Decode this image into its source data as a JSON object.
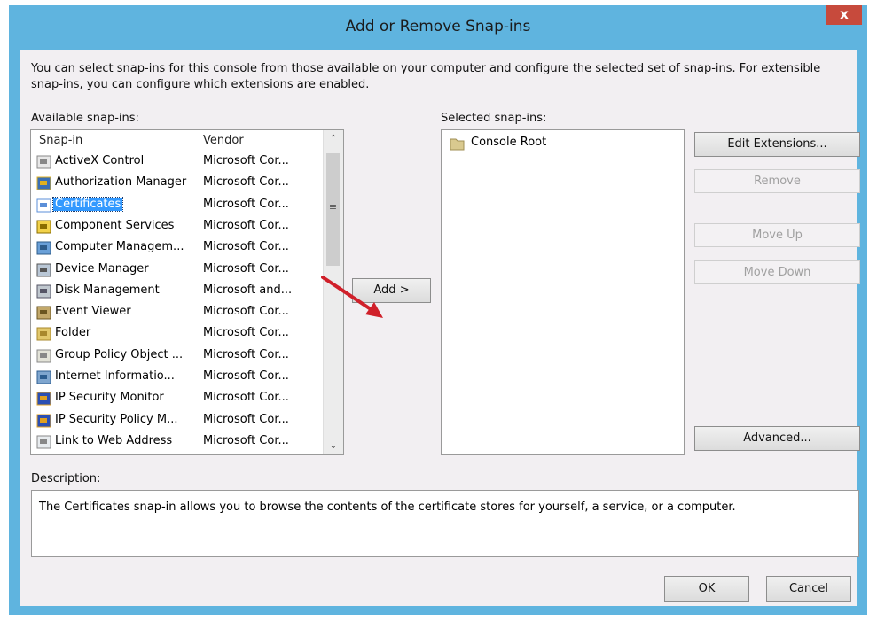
{
  "window": {
    "title": "Add or Remove Snap-ins",
    "close_label": "x"
  },
  "intro_text": "You can select snap-ins for this console from those available on your computer and configure the selected set of snap-ins. For extensible snap-ins, you can configure which extensions are enabled.",
  "available": {
    "label": "Available snap-ins:",
    "columns": [
      "Snap-in",
      "Vendor"
    ],
    "items": [
      {
        "name": "ActiveX Control",
        "vendor": "Microsoft Cor...",
        "icon": "activex-icon"
      },
      {
        "name": "Authorization Manager",
        "vendor": "Microsoft Cor...",
        "icon": "authorization-icon"
      },
      {
        "name": "Certificates",
        "vendor": "Microsoft Cor...",
        "icon": "certificate-icon",
        "selected": true
      },
      {
        "name": "Component Services",
        "vendor": "Microsoft Cor...",
        "icon": "component-services-icon"
      },
      {
        "name": "Computer Managem...",
        "vendor": "Microsoft Cor...",
        "icon": "computer-management-icon"
      },
      {
        "name": "Device Manager",
        "vendor": "Microsoft Cor...",
        "icon": "device-manager-icon"
      },
      {
        "name": "Disk Management",
        "vendor": "Microsoft and...",
        "icon": "disk-icon"
      },
      {
        "name": "Event Viewer",
        "vendor": "Microsoft Cor...",
        "icon": "event-viewer-icon"
      },
      {
        "name": "Folder",
        "vendor": "Microsoft Cor...",
        "icon": "folder-icon"
      },
      {
        "name": "Group Policy Object ...",
        "vendor": "Microsoft Cor...",
        "icon": "group-policy-icon"
      },
      {
        "name": "Internet Informatio...",
        "vendor": "Microsoft Cor...",
        "icon": "iis-icon"
      },
      {
        "name": "IP Security Monitor",
        "vendor": "Microsoft Cor...",
        "icon": "ip-security-icon"
      },
      {
        "name": "IP Security Policy M...",
        "vendor": "Microsoft Cor...",
        "icon": "ip-security-icon"
      },
      {
        "name": "Link to Web Address",
        "vendor": "Microsoft Cor...",
        "icon": "link-icon"
      }
    ]
  },
  "add_button": "Add >",
  "selected": {
    "label": "Selected snap-ins:",
    "items": [
      {
        "name": "Console Root",
        "icon": "folder-icon"
      }
    ]
  },
  "side_buttons": {
    "edit_extensions": "Edit Extensions...",
    "remove": "Remove",
    "move_up": "Move Up",
    "move_down": "Move Down",
    "advanced": "Advanced..."
  },
  "description": {
    "label": "Description:",
    "text": "The Certificates snap-in allows you to browse the contents of the certificate stores for yourself, a service, or a computer."
  },
  "footer": {
    "ok": "OK",
    "cancel": "Cancel"
  },
  "colors": {
    "titlebar": "#5fb4df",
    "selection": "#3399ff",
    "close": "#c74a3c",
    "arrow": "#d0202a"
  }
}
